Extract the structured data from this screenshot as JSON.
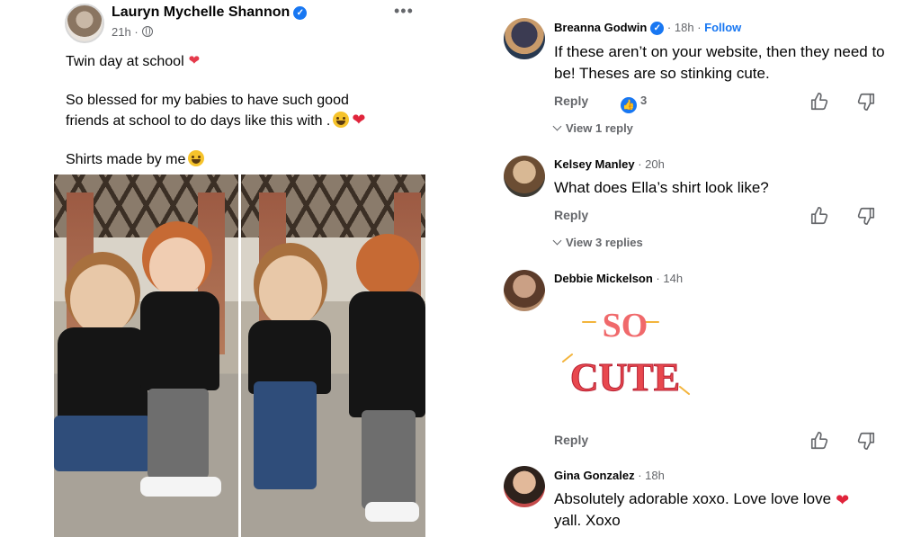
{
  "post": {
    "author": "Lauryn Mychelle Shannon",
    "time": "21h",
    "paragraphs": [
      "Twin day at school",
      "So blessed for my babies to have such good",
      "friends at school to do days like this with .",
      "Shirts made by me"
    ],
    "more_icon": "more-options-icon",
    "privacy_icon": "globe-icon"
  },
  "comments": [
    {
      "author": "Breanna Godwin",
      "time": "18h",
      "follow": "Follow",
      "text": "If these aren’t on your website, then they need to be! Theses are so stinking cute.",
      "reply": "Reply",
      "likes": "3",
      "view_replies": "View 1 reply"
    },
    {
      "author": "Kelsey Manley",
      "time": "20h",
      "text": "What does Ella’s shirt look like?",
      "reply": "Reply",
      "view_replies": "View 3 replies"
    },
    {
      "author": "Debbie Mickelson",
      "time": "14h",
      "sticker_line1": "SO",
      "sticker_line2": "CUTE",
      "reply": "Reply"
    },
    {
      "author": "Gina Gonzalez",
      "time": "18h",
      "text_line1": "Absolutely adorable xoxo. Love love love",
      "text_line2": "yall. Xoxo"
    }
  ],
  "colors": {
    "accent": "#1877f2",
    "secondary_text": "#65676b",
    "heart": "#e0243b"
  }
}
